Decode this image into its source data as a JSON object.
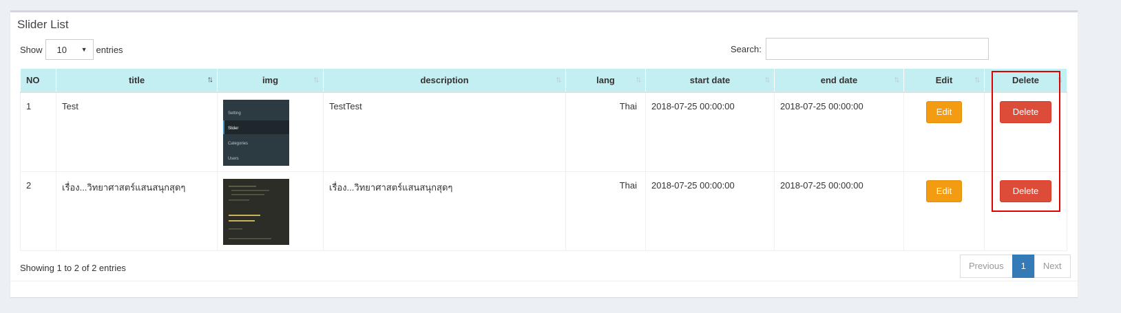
{
  "box": {
    "title": "Slider List"
  },
  "length": {
    "show_label": "Show",
    "value": "10",
    "entries_label": "entries"
  },
  "search": {
    "label": "Search:",
    "value": "",
    "placeholder": ""
  },
  "table": {
    "columns": [
      "NO",
      "title",
      "img",
      "description",
      "lang",
      "start date",
      "end date",
      "Edit",
      "Delete"
    ],
    "rows": [
      {
        "no": "1",
        "title": "Test",
        "img_icon": "sidebar-menu-screenshot-thumbnail",
        "img_lines": [
          "Setting",
          "Slider",
          "Categories",
          "Users"
        ],
        "description": "TestTest",
        "lang": "Thai",
        "start": "2018-07-25 00:00:00",
        "end": "2018-07-25 00:00:00",
        "edit": "Edit",
        "delete": "Delete"
      },
      {
        "no": "2",
        "title": "เรื่อง...วิทยาศาสตร์แสนสนุกสุดๆ",
        "img_icon": "code-editor-screenshot-thumbnail",
        "description": "เรื่อง...วิทยาศาสตร์แสนสนุกสุดๆ",
        "lang": "Thai",
        "start": "2018-07-25 00:00:00",
        "end": "2018-07-25 00:00:00",
        "edit": "Edit",
        "delete": "Delete"
      }
    ]
  },
  "footer": {
    "info": "Showing 1 to 2 of 2 entries"
  },
  "pagination": {
    "previous": "Previous",
    "current": "1",
    "next": "Next"
  },
  "colors": {
    "header_bg": "#c3eef2",
    "edit": "#f39c12",
    "delete": "#dd4b39",
    "highlight": "#e00000",
    "page_active": "#337ab7"
  }
}
